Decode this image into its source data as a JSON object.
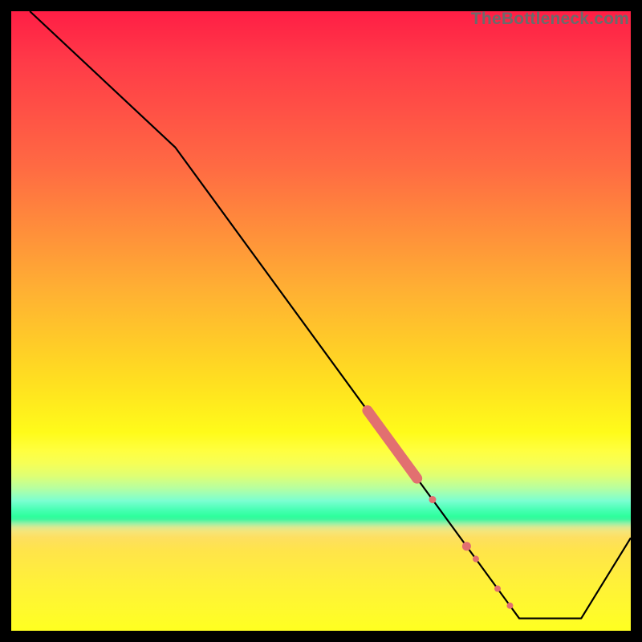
{
  "watermark": "TheBottleneck.com",
  "chart_data": {
    "type": "line",
    "title": "",
    "xlabel": "",
    "ylabel": "",
    "xlim": [
      0,
      100
    ],
    "ylim": [
      0,
      100
    ],
    "grid": false,
    "line": {
      "color": "#000000",
      "points": [
        [
          3.0,
          100.0
        ],
        [
          26.5,
          78.0
        ],
        [
          82.0,
          2.0
        ],
        [
          92.0,
          2.0
        ],
        [
          100.0,
          15.0
        ]
      ]
    },
    "highlight": {
      "color": "#e27070",
      "thick_segment": {
        "x_start": 57.5,
        "x_end": 65.5
      },
      "dots": [
        {
          "x": 68.0,
          "size": 9
        },
        {
          "x": 73.5,
          "size": 11
        },
        {
          "x": 75.0,
          "size": 8
        },
        {
          "x": 78.5,
          "size": 8
        },
        {
          "x": 80.5,
          "size": 8
        }
      ]
    }
  }
}
